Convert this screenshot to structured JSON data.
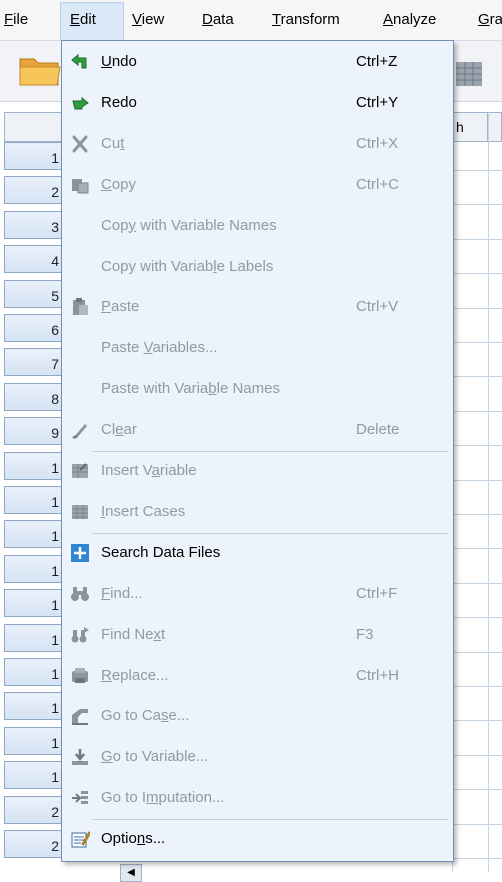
{
  "menubar": {
    "items": [
      {
        "label": "File",
        "mnemonic": "F"
      },
      {
        "label": "Edit",
        "mnemonic": "E"
      },
      {
        "label": "View",
        "mnemonic": "V"
      },
      {
        "label": "Data",
        "mnemonic": "D"
      },
      {
        "label": "Transform",
        "mnemonic": "T"
      },
      {
        "label": "Analyze",
        "mnemonic": "A"
      },
      {
        "label": "Gra",
        "mnemonic": "G"
      }
    ],
    "active": "Edit"
  },
  "grid": {
    "column_header_partial": "h",
    "row_numbers": [
      "1",
      "2",
      "3",
      "4",
      "5",
      "6",
      "7",
      "8",
      "9",
      "1",
      "1",
      "1",
      "1",
      "1",
      "1",
      "1",
      "1",
      "1",
      "1",
      "2",
      "2"
    ]
  },
  "edit_menu": {
    "items": [
      {
        "label_pre": "",
        "mnemonic": "U",
        "label_post": "ndo",
        "shortcut": "Ctrl+Z",
        "enabled": true,
        "icon": "undo-icon"
      },
      {
        "label_pre": "",
        "mnemonic": "",
        "label_post": "Redo",
        "shortcut": "Ctrl+Y",
        "enabled": true,
        "icon": "redo-icon"
      },
      {
        "label_pre": "Cu",
        "mnemonic": "t",
        "label_post": "",
        "shortcut": "Ctrl+X",
        "enabled": false,
        "icon": "cut-icon"
      },
      {
        "label_pre": "",
        "mnemonic": "C",
        "label_post": "opy",
        "shortcut": "Ctrl+C",
        "enabled": false,
        "icon": "copy-icon"
      },
      {
        "label_pre": "Cop",
        "mnemonic": "y",
        "label_post": " with Variable Names",
        "shortcut": "",
        "enabled": false,
        "icon": ""
      },
      {
        "label_pre": "Copy with Variab",
        "mnemonic": "l",
        "label_post": "e Labels",
        "shortcut": "",
        "enabled": false,
        "icon": ""
      },
      {
        "label_pre": "",
        "mnemonic": "P",
        "label_post": "aste",
        "shortcut": "Ctrl+V",
        "enabled": false,
        "icon": "paste-icon"
      },
      {
        "label_pre": "Paste ",
        "mnemonic": "V",
        "label_post": "ariables...",
        "shortcut": "",
        "enabled": false,
        "icon": ""
      },
      {
        "label_pre": "Paste with Varia",
        "mnemonic": "b",
        "label_post": "le Names",
        "shortcut": "",
        "enabled": false,
        "icon": ""
      },
      {
        "label_pre": "Cl",
        "mnemonic": "e",
        "label_post": "ar",
        "shortcut": "Delete",
        "enabled": false,
        "icon": "clear-icon"
      },
      {
        "label_pre": "Insert V",
        "mnemonic": "a",
        "label_post": "riable",
        "shortcut": "",
        "enabled": false,
        "icon": "insert-variable-icon"
      },
      {
        "label_pre": "",
        "mnemonic": "I",
        "label_post": "nsert Cases",
        "shortcut": "",
        "enabled": false,
        "icon": "insert-cases-icon"
      },
      {
        "label_pre": "",
        "mnemonic": "",
        "label_post": "Search Data Files",
        "shortcut": "",
        "enabled": true,
        "icon": "search-data-files-icon"
      },
      {
        "label_pre": "",
        "mnemonic": "F",
        "label_post": "ind...",
        "shortcut": "Ctrl+F",
        "enabled": false,
        "icon": "binoculars-icon"
      },
      {
        "label_pre": "Find Ne",
        "mnemonic": "x",
        "label_post": "t",
        "shortcut": "F3",
        "enabled": false,
        "icon": "find-next-icon"
      },
      {
        "label_pre": "",
        "mnemonic": "R",
        "label_post": "eplace...",
        "shortcut": "Ctrl+H",
        "enabled": false,
        "icon": "replace-icon"
      },
      {
        "label_pre": "Go to Ca",
        "mnemonic": "s",
        "label_post": "e...",
        "shortcut": "",
        "enabled": false,
        "icon": "go-to-case-icon"
      },
      {
        "label_pre": "",
        "mnemonic": "G",
        "label_post": "o to Variable...",
        "shortcut": "",
        "enabled": false,
        "icon": "go-to-variable-icon"
      },
      {
        "label_pre": "Go to I",
        "mnemonic": "m",
        "label_post": "putation...",
        "shortcut": "",
        "enabled": false,
        "icon": "go-to-imputation-icon"
      },
      {
        "label_pre": "Optio",
        "mnemonic": "n",
        "label_post": "s...",
        "shortcut": "",
        "enabled": true,
        "icon": "options-icon"
      }
    ]
  },
  "colors": {
    "menu_bg": "#edf3fa",
    "menu_border": "#6f8fb8",
    "disabled_text": "#9099a6",
    "active_menubar": "#dbe8f7"
  }
}
